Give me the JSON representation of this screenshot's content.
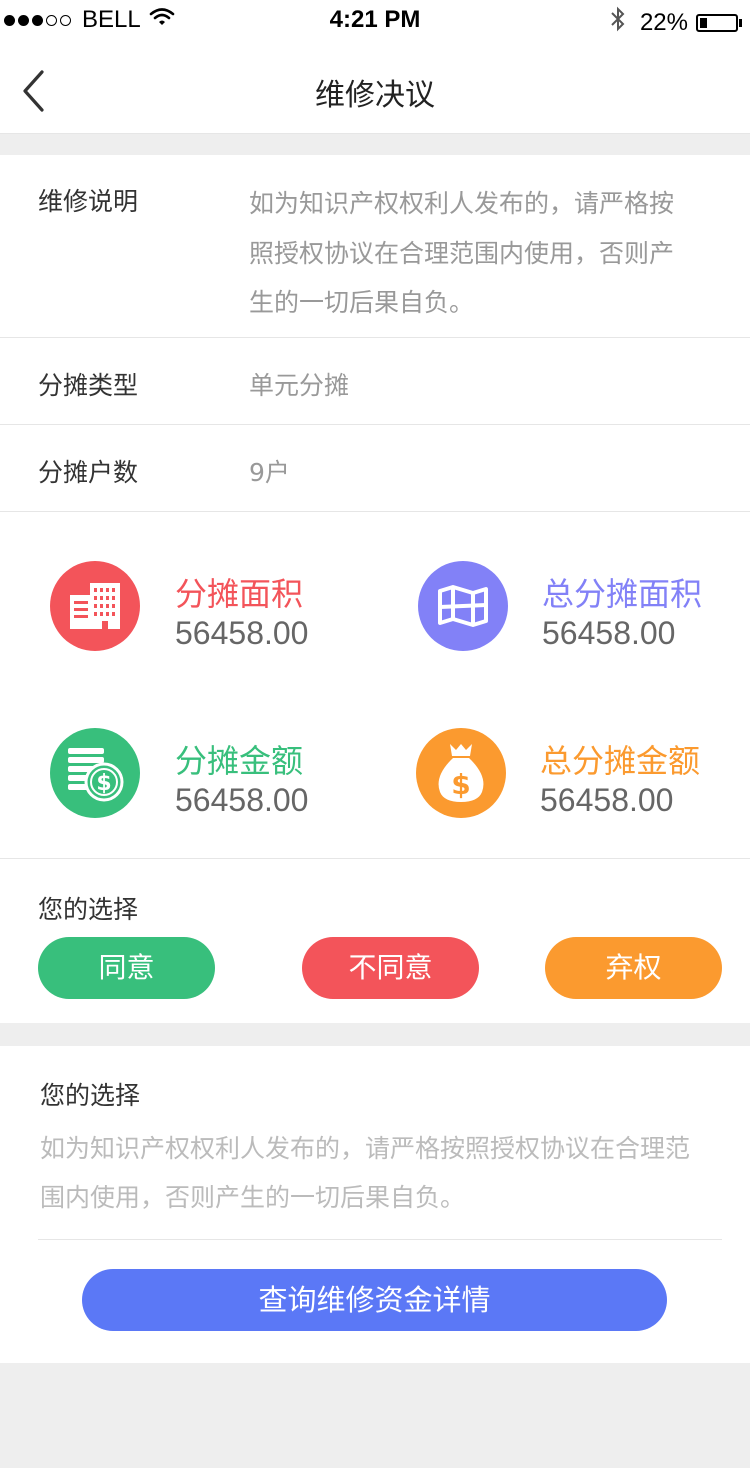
{
  "status_bar": {
    "carrier": "BELL",
    "time": "4:21 PM",
    "battery": "22%",
    "battery_level": 0.22,
    "signal_dots_filled": 3,
    "signal_dots_total": 5,
    "icons": [
      "signal-dots-icon",
      "wifi-icon",
      "bluetooth-icon",
      "battery-icon"
    ]
  },
  "nav": {
    "title": "维修决议",
    "back_icon": "chevron-left-icon"
  },
  "details": {
    "description_label": "维修说明",
    "description_value": "如为知识产权权利人发布的，请严格按照授权协议在合理范围内使用，否则产生的一切后果自负。",
    "type_label": "分摊类型",
    "type_value": "单元分摊",
    "households_label": "分摊户数",
    "households_value": "9户"
  },
  "stats": [
    {
      "label": "分摊面积",
      "value": "56458.00",
      "color": "#f3545a",
      "icon": "building-icon"
    },
    {
      "label": "总分摊面积",
      "value": "56458.00",
      "color": "#8281f7",
      "icon": "map-icon"
    },
    {
      "label": "分摊金额",
      "value": "56458.00",
      "color": "#38bf7c",
      "icon": "coins-icon"
    },
    {
      "label": "总分摊金额",
      "value": "56458.00",
      "color": "#fb9a2f",
      "icon": "money-bag-icon"
    }
  ],
  "choice": {
    "title": "您的选择",
    "buttons": [
      {
        "label": "同意",
        "color": "#38bf7c"
      },
      {
        "label": "不同意",
        "color": "#f3545a"
      },
      {
        "label": "弃权",
        "color": "#fb9a2f"
      }
    ]
  },
  "result": {
    "title": "您的选择",
    "description": "如为知识产权权利人发布的，请严格按照授权协议在合理范围内使用，否则产生的一切后果自负。",
    "query_button": "查询维修资金详情",
    "query_color": "#5b78f6"
  }
}
